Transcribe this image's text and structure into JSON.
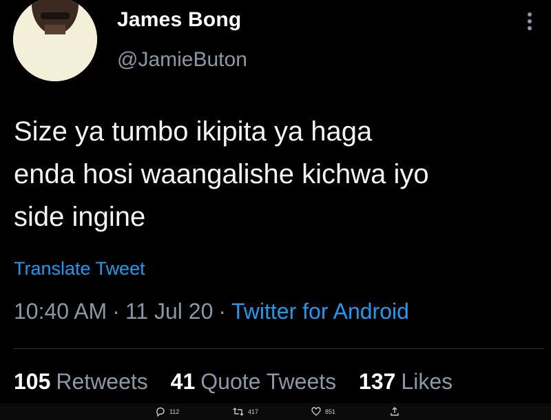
{
  "author": {
    "display_name": "James Bong",
    "handle": "@JamieButon"
  },
  "tweet": {
    "text_lines": [
      "Size ya tumbo ikipita ya haga",
      "enda hosi waangalishe kichwa iyo",
      "side ingine"
    ],
    "translate_label": "Translate Tweet",
    "time": "10:40 AM",
    "date": "11 Jul 20",
    "source": "Twitter for Android",
    "separator": "·"
  },
  "stats": {
    "retweets": {
      "count": "105",
      "label": "Retweets"
    },
    "quotes": {
      "count": "41",
      "label": "Quote Tweets"
    },
    "likes": {
      "count": "137",
      "label": "Likes"
    }
  },
  "action_bar": {
    "reply_count": "112",
    "retweet_count": "417",
    "like_count": "851"
  },
  "icons": {
    "more": "more-vertical-icon",
    "reply": "reply-icon",
    "retweet": "retweet-icon",
    "like": "heart-icon",
    "share": "share-icon"
  },
  "colors": {
    "background": "#000000",
    "accent": "#1d9bf0",
    "secondary_text": "#8b98a5",
    "primary_text": "#ffffff"
  }
}
